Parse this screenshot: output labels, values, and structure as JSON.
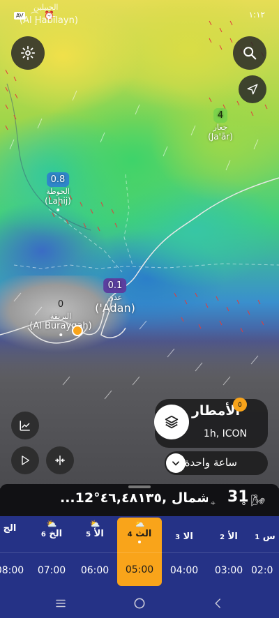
{
  "status_bar": {
    "time": "١:١٢",
    "top_label_ar": "الحبيلين",
    "top_label_en": "(Al Ḩabīlayn)",
    "icon_badge": "AV"
  },
  "map": {
    "markers": [
      {
        "value": "4",
        "ar": "جعار",
        "en": "(Ja'ār)",
        "color": "#7bd34b"
      },
      {
        "value": "0.8",
        "ar": "الحوطة",
        "en": "(Laḩij)",
        "color": "#2f86c9"
      },
      {
        "value": "0.1",
        "ar": "عدن",
        "en": "('Adan)",
        "color": "#5b3f9f"
      },
      {
        "value": "0",
        "ar": "البريقة",
        "en": "(Al Burayqah)",
        "color": "transparent"
      }
    ]
  },
  "layer_panel": {
    "title": "الأمطار",
    "subtitle": "1h, ICON",
    "new_badge": "٥",
    "hour_label": "ساعة واحدة"
  },
  "info_bar": {
    "temperature": "31",
    "degree": "°",
    "location": "...شمال ,٤٦,٤٨١٣٥°12\""
  },
  "timeline": {
    "days": [
      {
        "label": "الج",
        "num": ""
      },
      {
        "label": "الخ",
        "num": "6"
      },
      {
        "label": "الأ",
        "num": "5"
      },
      {
        "label": "الث",
        "num": "4"
      },
      {
        "label": "الا",
        "num": "3"
      },
      {
        "label": "الأ",
        "num": "2"
      },
      {
        "label": "س",
        "num": "1"
      }
    ],
    "times": [
      "08:00",
      "07:00",
      "06:00",
      "05:00",
      "04:00",
      "03:00",
      "02:0"
    ],
    "selected_index": 3
  },
  "colors": {
    "accent": "#f9a41a",
    "timeline_bg": "#253286"
  }
}
